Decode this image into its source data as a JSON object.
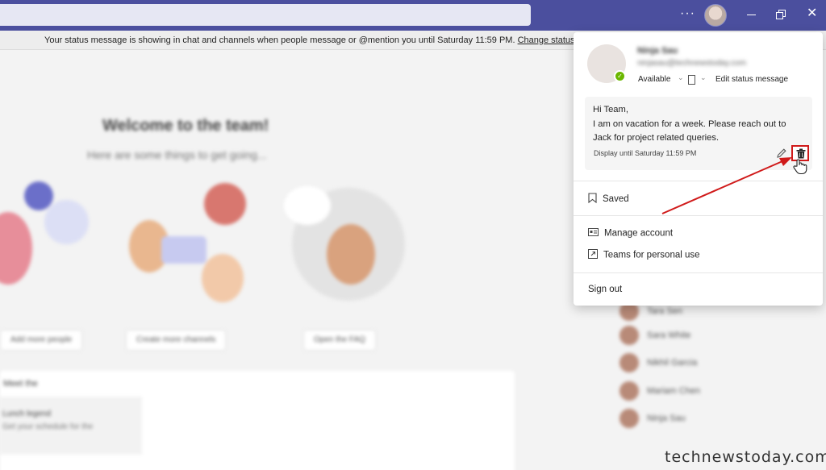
{
  "banner": {
    "text": "Your status message is showing in chat and channels when people message or @mention you until Saturday 11:59 PM.",
    "link": "Change status."
  },
  "background": {
    "welcome_title": "Welcome to the team!",
    "welcome_sub": "Here are some things to get going...",
    "buttons": [
      "Add more people",
      "Create more channels",
      "Open the FAQ"
    ],
    "card_title": "Meet the",
    "card_line1": "Lunch legend",
    "card_line2": "Get your schedule for the"
  },
  "profile": {
    "name": "Ninja Sau",
    "email": "ninjasau@technewstoday.com",
    "status": "Available",
    "edit_status": "Edit status message"
  },
  "status_message": {
    "lines": [
      "Hi Team,",
      "I am on vacation for a week. Please reach out to",
      "Jack for project related queries."
    ],
    "display_until": "Display until Saturday 11:59 PM"
  },
  "menu": {
    "saved": "Saved",
    "manage_account": "Manage account",
    "teams_personal": "Teams for personal use",
    "sign_out": "Sign out"
  },
  "people": [
    "Tara Sen",
    "Sara White",
    "Nikhil Garcia",
    "Mariam Chen",
    "Ninja Sau"
  ],
  "watermark": "technewstoday.com",
  "colors": {
    "titlebar": "#4b4f9e",
    "presence": "#6bb700",
    "highlight": "#d01a1a"
  },
  "icons": [
    "more-options-icon",
    "minimize-icon",
    "restore-icon",
    "close-icon",
    "presence-available-icon",
    "document-icon",
    "pencil-icon",
    "trash-icon",
    "bookmark-icon",
    "id-card-icon",
    "external-link-icon",
    "hand-cursor-icon"
  ]
}
